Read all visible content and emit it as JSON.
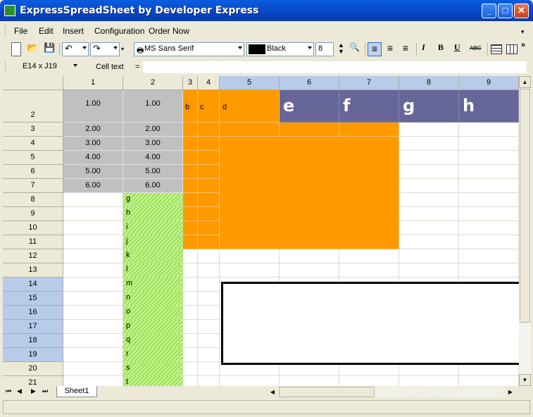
{
  "window": {
    "title": "ExpressSpreadSheet by Developer Express"
  },
  "menu": [
    "File",
    "Edit",
    "Insert",
    "Configuration",
    "Order Now"
  ],
  "toolbar": {
    "font_name": "MS Sans Serif",
    "color_name": "Black",
    "font_size": "8",
    "italic": "I",
    "bold": "B",
    "underline": "U",
    "strike": "ABC"
  },
  "formula": {
    "cell_ref": "E14 x J19",
    "label": "Cell text",
    "equals": "=",
    "value": ""
  },
  "columns": [
    "1",
    "2",
    "3",
    "4",
    "5",
    "6",
    "7",
    "8",
    "9"
  ],
  "rows": [
    "2",
    "3",
    "4",
    "5",
    "6",
    "7",
    "8",
    "9",
    "10",
    "11",
    "12",
    "13",
    "14",
    "15",
    "16",
    "17",
    "18",
    "19",
    "20",
    "21"
  ],
  "cells": {
    "gray": [
      [
        "1.00",
        "1.00"
      ],
      [
        "2.00",
        "2.00"
      ],
      [
        "3.00",
        "3.00"
      ],
      [
        "4.00",
        "4.00"
      ],
      [
        "5.00",
        "5.00"
      ],
      [
        "6.00",
        "6.00"
      ]
    ],
    "row2_text": [
      "b",
      "c",
      "d"
    ],
    "headers_big": [
      "e",
      "f",
      "g",
      "h"
    ],
    "green_letters": [
      "g",
      "h",
      "i",
      "j",
      "k",
      "l",
      "m",
      "n",
      "o",
      "p",
      "q",
      "r",
      "s",
      "t"
    ]
  },
  "sheet": {
    "tab": "Sheet1"
  }
}
